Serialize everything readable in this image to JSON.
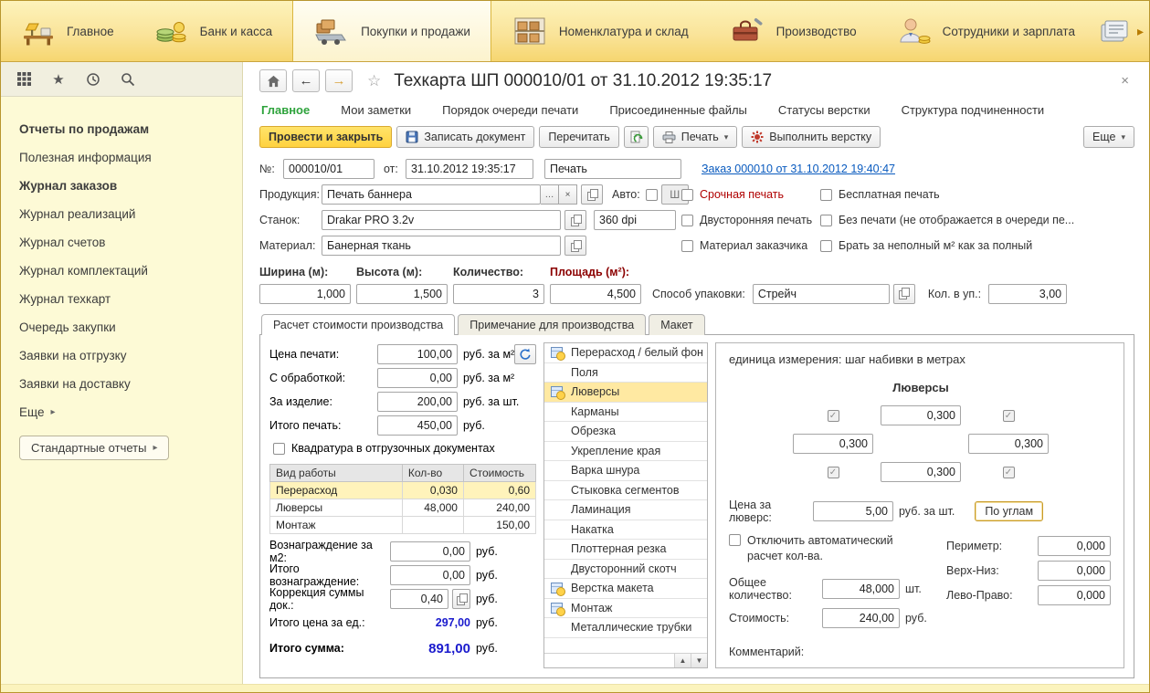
{
  "icons": {
    "back": "←",
    "forward": "→",
    "favorite_star": "☆",
    "close": "×",
    "caret_down": "▾",
    "chevron_right": "▸",
    "check": "✓",
    "scroll_up": "▲",
    "scroll_down": "▼",
    "ellipsis": "…",
    "clear": "×",
    "star": "★"
  },
  "colors": {
    "ribbon_yellow": "#f8da72",
    "primary_button_yellow": "#ffd83e",
    "active_tab_green": "#2ea33c",
    "urgent_red": "#b00000",
    "totals_blue": "#1a1acd",
    "link_blue": "#0a5bbf"
  },
  "ribbon": {
    "items": [
      "Главное",
      "Банк и касса",
      "Покупки и продажи",
      "Номенклатура и склад",
      "Производство",
      "Сотрудники и зарплата"
    ]
  },
  "sidebar": {
    "items": [
      "Отчеты по продажам",
      "Полезная информация",
      "Журнал заказов",
      "Журнал реализаций",
      "Журнал счетов",
      "Журнал комплектаций",
      "Журнал техкарт",
      "Очередь закупки",
      "Заявки на отгрузку",
      "Заявки на доставку",
      "Еще"
    ],
    "standard_reports": "Стандартные отчеты"
  },
  "doc": {
    "title": "Техкарта ШП 000010/01 от 31.10.2012 19:35:17",
    "nav_tabs": [
      "Главное",
      "Мои заметки",
      "Порядок очереди печати",
      "Присоединенные файлы",
      "Статусы верстки",
      "Структура подчиненности"
    ],
    "toolbar": {
      "post_and_close": "Провести и закрыть",
      "save_document": "Записать документ",
      "reread": "Перечитать",
      "print": "Печать",
      "run_layout": "Выполнить верстку",
      "more": "Еще"
    },
    "header": {
      "no_label": "№:",
      "no_value": "000010/01",
      "from_label": "от:",
      "from_value": "31.10.2012 19:35:17",
      "kind_value": "Печать",
      "order_link": "Заказ 000010 от 31.10.2012 19:40:47",
      "product_label": "Продукция:",
      "product_value": "Печать баннера",
      "auto_label": "Авто:",
      "sh_button": "Ш",
      "urgent_label": "Срочная печать",
      "free_label": "Бесплатная печать",
      "machine_label": "Станок:",
      "machine_value": "Drakar PRO 3.2v",
      "dpi_value": "360 dpi",
      "duplex_label": "Двусторонняя печать",
      "noprint_label": "Без печати (не отображается в очереди пе...",
      "material_label": "Материал:",
      "material_value": "Банерная ткань",
      "customer_material_label": "Материал заказчика",
      "partial_sqm_label": "Брать за неполный м²  как за полный"
    },
    "dims": {
      "width_label": "Ширина (м):",
      "width_value": "1,000",
      "height_label": "Высота (м):",
      "height_value": "1,500",
      "qty_label": "Количество:",
      "qty_value": "3",
      "area_label": "Площадь (м²):",
      "area_value": "4,500",
      "pack_label": "Способ упаковки:",
      "pack_value": "Стрейч",
      "per_pack_label": "Кол. в уп.:",
      "per_pack_value": "3,00"
    },
    "calc_tabs": [
      "Расчет стоимости производства",
      "Примечание для производства",
      "Макет"
    ],
    "pricing": {
      "rows": [
        {
          "label": "Цена печати:",
          "value": "100,00",
          "suffix": "руб. за м²"
        },
        {
          "label": "С обработкой:",
          "value": "0,00",
          "suffix": "руб. за м²"
        },
        {
          "label": "За изделие:",
          "value": "200,00",
          "suffix": "руб. за шт."
        },
        {
          "label": "Итого печать:",
          "value": "450,00",
          "suffix": "руб."
        }
      ],
      "quadrature_label": "Квадратура в отгрузочных документах",
      "table": {
        "headers": [
          "Вид работы",
          "Кол-во",
          "Стоимость"
        ],
        "rows": [
          {
            "name": "Перерасход",
            "qty": "0,030",
            "cost": "0,60"
          },
          {
            "name": "Люверсы",
            "qty": "48,000",
            "cost": "240,00"
          },
          {
            "name": "Монтаж",
            "qty": "",
            "cost": "150,00"
          }
        ]
      },
      "bottom_rows": [
        {
          "label": "Вознаграждение за м2:",
          "value": "0,00",
          "suffix": "руб."
        },
        {
          "label": "Итого вознаграждение:",
          "value": "0,00",
          "suffix": "руб."
        },
        {
          "label": "Коррекция суммы док.:",
          "value": "0,40",
          "suffix": "руб."
        }
      ],
      "unit_total_label": "Итого цена за ед.:",
      "unit_total_value": "297,00",
      "unit_total_suffix": "руб.",
      "grand_total_label": "Итого сумма:",
      "grand_total_value": "891,00",
      "grand_total_suffix": "руб."
    },
    "ops": {
      "items": [
        "Перерасход / белый фон",
        "Поля",
        "Люверсы",
        "Карманы",
        "Обрезка",
        "Укрепление края",
        "Варка шнура",
        "Стыковка сегментов",
        "Ламинация",
        "Накатка",
        "Плоттерная резка",
        "Двусторонний скотч",
        "Верстка макета",
        "Монтаж",
        "Металлические трубки"
      ]
    },
    "detail": {
      "unit_hint": "единица измерения: шаг набивки в метрах",
      "title": "Люверсы",
      "grid": {
        "top": "0,300",
        "left": "0,300",
        "right": "0,300",
        "bottom": "0,300"
      },
      "price_label": "Цена за люверс:",
      "price_value": "5,00",
      "price_suffix": "руб. за шт.",
      "corners_button": "По углам",
      "auto_calc_label": "Отключить автоматический расчет кол-ва.",
      "perimeter_label": "Периметр:",
      "perimeter_value": "0,000",
      "topbottom_label": "Верх-Низ:",
      "topbottom_value": "0,000",
      "leftright_label": "Лево-Право:",
      "leftright_value": "0,000",
      "total_qty_label": "Общее количество:",
      "total_qty_value": "48,000",
      "total_qty_suffix": "шт.",
      "cost_label": "Стоимость:",
      "cost_value": "240,00",
      "cost_suffix": "руб.",
      "comment_label": "Комментарий:"
    }
  }
}
